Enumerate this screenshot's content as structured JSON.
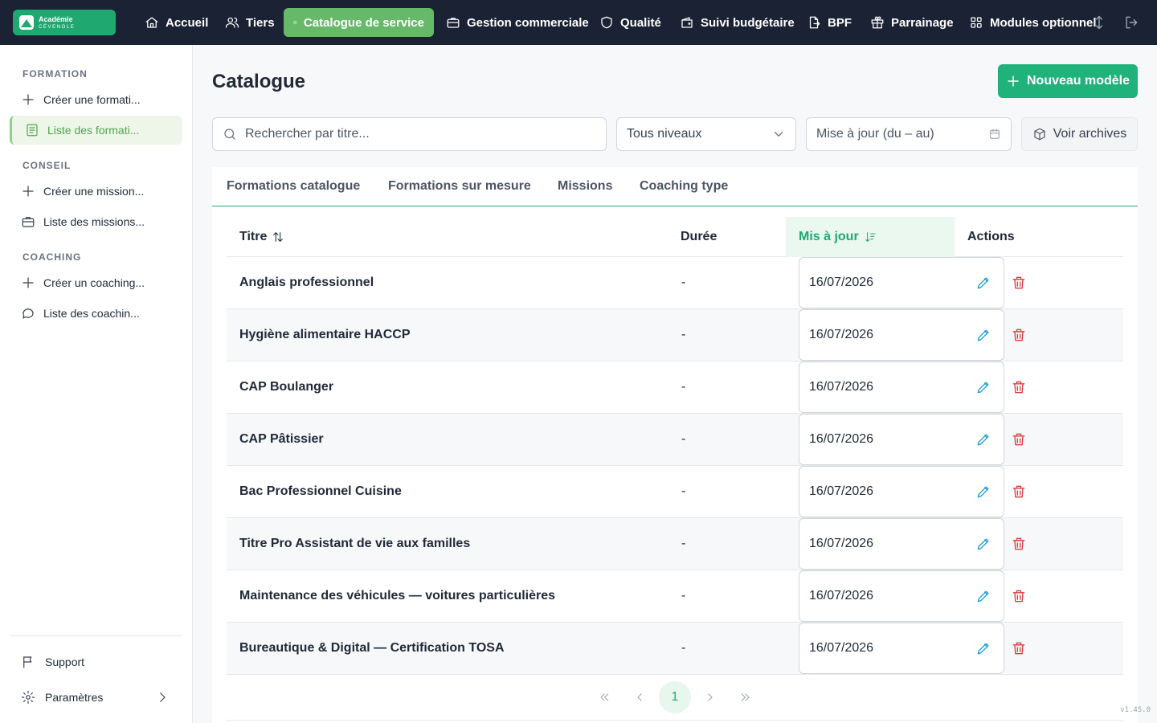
{
  "brand": {
    "line1": "Académie",
    "line2": "CÉVENOLE"
  },
  "nav": {
    "items": [
      {
        "label": "Accueil",
        "icon": "home-icon"
      },
      {
        "label": "Tiers",
        "icon": "users-icon"
      },
      {
        "label": "Catalogue de service",
        "icon": "catalog-icon",
        "active": true
      },
      {
        "label": "Gestion commerciale",
        "icon": "briefcase-icon"
      },
      {
        "label": "Qualité",
        "icon": "shield-icon"
      },
      {
        "label": "Suivi budgétaire",
        "icon": "wallet-icon"
      },
      {
        "label": "BPF",
        "icon": "file-export-icon"
      },
      {
        "label": "Parrainage",
        "icon": "gift-icon"
      },
      {
        "label": "Modules optionnel",
        "icon": "grid-icon"
      }
    ]
  },
  "sidebar": {
    "sections": [
      {
        "title": "FORMATION",
        "items": [
          {
            "label": "Créer une formati...",
            "icon": "plus-icon"
          },
          {
            "label": "Liste des formati...",
            "icon": "list-icon",
            "active": true
          }
        ]
      },
      {
        "title": "CONSEIL",
        "items": [
          {
            "label": "Créer une mission...",
            "icon": "plus-icon"
          },
          {
            "label": "Liste des missions...",
            "icon": "briefcase-icon"
          }
        ]
      },
      {
        "title": "COACHING",
        "items": [
          {
            "label": "Créer un coaching...",
            "icon": "plus-icon"
          },
          {
            "label": "Liste des coachin...",
            "icon": "chat-icon"
          }
        ]
      }
    ],
    "support_label": "Support",
    "settings_label": "Paramètres"
  },
  "main": {
    "title": "Catalogue",
    "new_button": "Nouveau modèle",
    "search_placeholder": "Rechercher par titre...",
    "level_select": "Tous niveaux",
    "date_placeholder": "Mise à jour (du – au)",
    "archives_button": "Voir archives",
    "tabs": [
      "Formations catalogue",
      "Formations sur mesure",
      "Missions",
      "Coaching type"
    ],
    "table": {
      "headers": {
        "title": "Titre",
        "duration": "Durée",
        "updated": "Mis à jour",
        "actions": "Actions"
      },
      "rows": [
        {
          "title": "Anglais professionnel",
          "duration": "-",
          "updated": "16/07/2026"
        },
        {
          "title": "Hygiène alimentaire HACCP",
          "duration": "-",
          "updated": "16/07/2026"
        },
        {
          "title": "CAP Boulanger",
          "duration": "-",
          "updated": "16/07/2026"
        },
        {
          "title": "CAP Pâtissier",
          "duration": "-",
          "updated": "16/07/2026"
        },
        {
          "title": "Bac Professionnel Cuisine",
          "duration": "-",
          "updated": "16/07/2026"
        },
        {
          "title": "Titre Pro Assistant de vie aux familles",
          "duration": "-",
          "updated": "16/07/2026"
        },
        {
          "title": "Maintenance des véhicules — voitures particulières",
          "duration": "-",
          "updated": "16/07/2026"
        },
        {
          "title": "Bureautique & Digital — Certification TOSA",
          "duration": "-",
          "updated": "16/07/2026"
        }
      ]
    },
    "pagination": {
      "current_page": "1"
    }
  },
  "version": "v1.45.0",
  "colors": {
    "accent": "#1fa971",
    "nav_bg": "#1a2234",
    "active_nav": "#67b96a",
    "edit": "#1a9bd7",
    "delete": "#dc3b3b"
  }
}
